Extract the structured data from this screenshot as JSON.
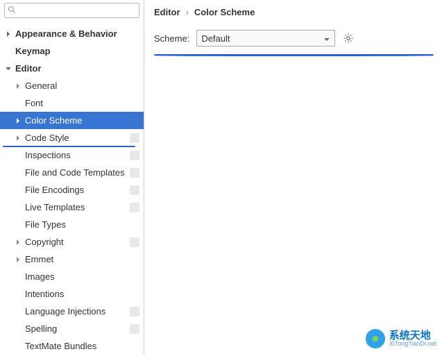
{
  "search": {
    "placeholder": ""
  },
  "sidebar": {
    "top": [
      {
        "label": "Appearance & Behavior",
        "expanded": false
      },
      {
        "label": "Keymap",
        "expanded": null
      },
      {
        "label": "Editor",
        "expanded": true
      }
    ],
    "editorChildren": [
      {
        "label": "General",
        "arrow": true
      },
      {
        "label": "Font",
        "arrow": false
      },
      {
        "label": "Color Scheme",
        "arrow": true,
        "selected": true
      },
      {
        "label": "Code Style",
        "arrow": true,
        "badge": true
      },
      {
        "label": "Inspections",
        "arrow": false,
        "badge": true
      },
      {
        "label": "File and Code Templates",
        "arrow": false,
        "badge": true
      },
      {
        "label": "File Encodings",
        "arrow": false,
        "badge": true
      },
      {
        "label": "Live Templates",
        "arrow": false,
        "badge": true
      },
      {
        "label": "File Types",
        "arrow": false
      },
      {
        "label": "Copyright",
        "arrow": true,
        "badge": true
      },
      {
        "label": "Emmet",
        "arrow": true
      },
      {
        "label": "Images",
        "arrow": false
      },
      {
        "label": "Intentions",
        "arrow": false
      },
      {
        "label": "Language Injections",
        "arrow": false,
        "badge": true
      },
      {
        "label": "Spelling",
        "arrow": false,
        "badge": true
      },
      {
        "label": "TextMate Bundles",
        "arrow": false
      }
    ]
  },
  "breadcrumb": {
    "a": "Editor",
    "sep": "›",
    "b": "Color Scheme"
  },
  "scheme": {
    "label": "Scheme:",
    "value": "Default"
  },
  "watermark": {
    "cn": "系统天地",
    "en": "XiTongTianDi.net"
  }
}
